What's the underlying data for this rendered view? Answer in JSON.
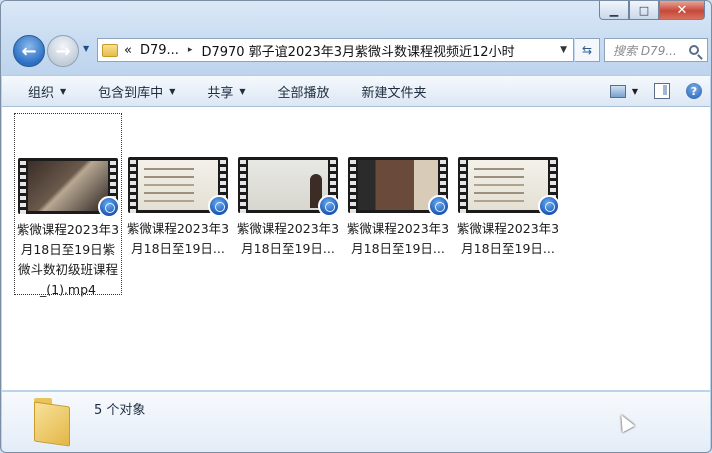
{
  "window": {
    "caption_buttons": {
      "minimize": "▁",
      "maximize": "□",
      "close": "✕"
    }
  },
  "nav": {
    "back_icon": "←",
    "forward_icon": "→",
    "history_icon": "▼",
    "breadcrumb_overflow": "«",
    "breadcrumbs": [
      "D79...",
      "D7970 郭子谊2023年3月紫微斗数课程视频近12小时"
    ],
    "crumb_separator": "▸",
    "address_dropdown": "▼",
    "refresh_icon": "⇆",
    "search_placeholder": "搜索 D79..."
  },
  "toolbar": {
    "organize": "组织",
    "include_library": "包含到库中",
    "share": "共享",
    "play_all": "全部播放",
    "new_folder": "新建文件夹",
    "dropdown_arrow": "▼",
    "help_label": "?"
  },
  "files": [
    {
      "name": "紫微课程2023年3月18日至19日紫微斗数初级班课程_(1).mp4",
      "selected": true,
      "frame": "dark"
    },
    {
      "name": "紫微课程2023年3月18日至19日...",
      "selected": false,
      "frame": "white"
    },
    {
      "name": "紫微课程2023年3月18日至19日...",
      "selected": false,
      "frame": "board"
    },
    {
      "name": "紫微课程2023年3月18日至19日...",
      "selected": false,
      "frame": "mixed"
    },
    {
      "name": "紫微课程2023年3月18日至19日...",
      "selected": false,
      "frame": "white"
    }
  ],
  "status": {
    "count": "5 个对象"
  }
}
